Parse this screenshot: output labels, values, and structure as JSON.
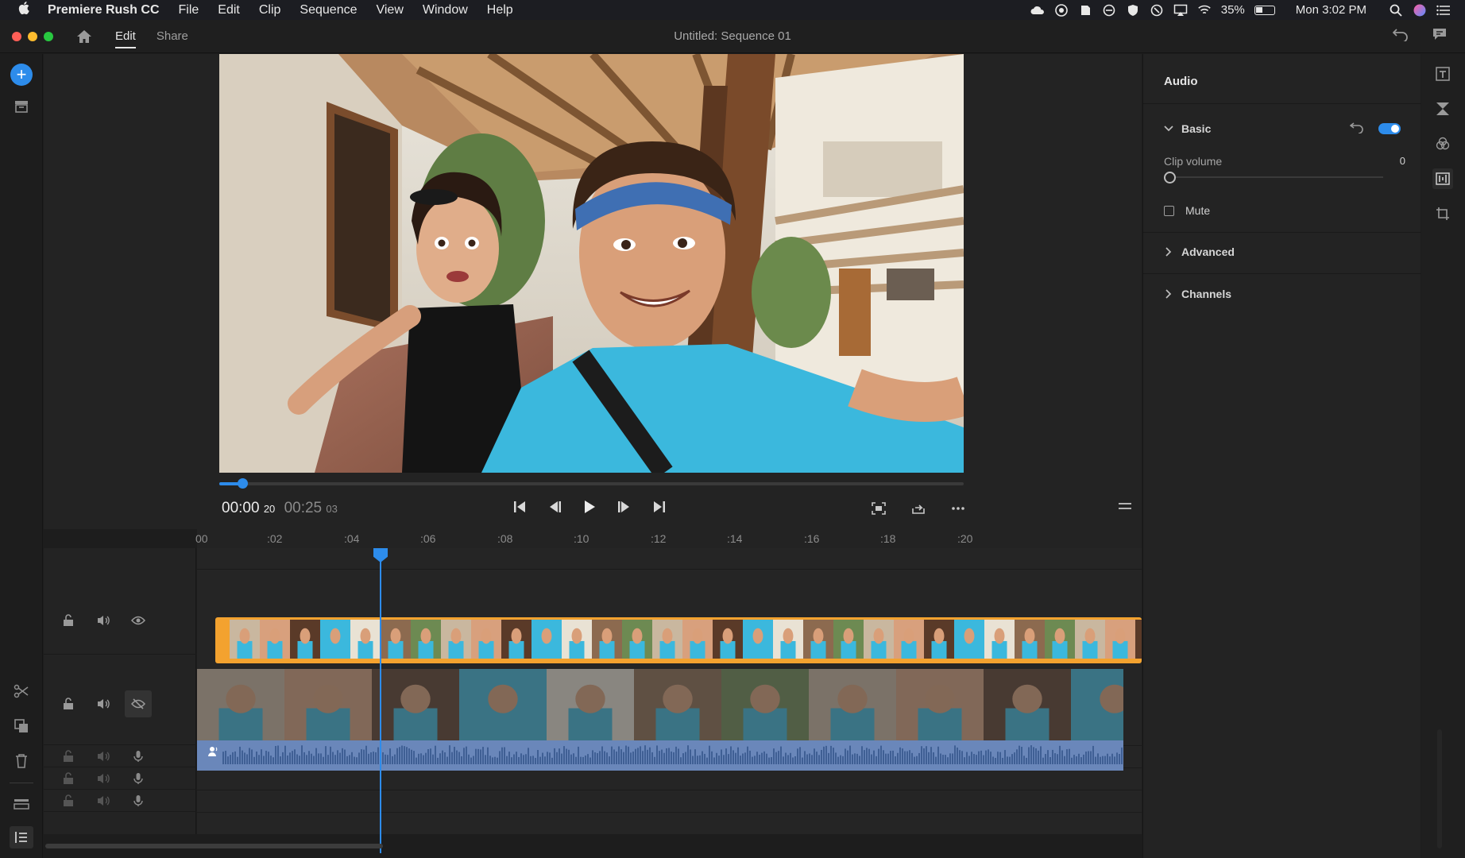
{
  "menubar": {
    "app_name": "Premiere Rush CC",
    "items": [
      "File",
      "Edit",
      "Clip",
      "Sequence",
      "View",
      "Window",
      "Help"
    ],
    "battery": "35%",
    "clock": "Mon 3:02 PM"
  },
  "titlebar": {
    "tabs": [
      {
        "label": "Edit",
        "active": true
      },
      {
        "label": "Share",
        "active": false
      }
    ],
    "title": "Untitled: Sequence 01"
  },
  "preview": {
    "current_time": "00:00",
    "current_frames": "20",
    "duration_time": "00:25",
    "duration_frames": "03",
    "playhead_fraction": 0.031
  },
  "timeline": {
    "ruler_labels": [
      "00",
      ":02",
      ":04",
      ":06",
      ":08",
      ":10",
      ":12",
      ":14",
      ":16",
      ":18",
      ":20"
    ],
    "tracks": [
      {
        "kind": "video-overlay",
        "locked": false,
        "muted": false,
        "visible": true
      },
      {
        "kind": "video-main",
        "locked": false,
        "muted": false,
        "visible": false
      },
      {
        "kind": "audio",
        "locked": false
      },
      {
        "kind": "audio",
        "locked": false
      },
      {
        "kind": "audio",
        "locked": false
      }
    ]
  },
  "audio_panel": {
    "title": "Audio",
    "sections": [
      {
        "label": "Basic",
        "expanded": true,
        "enabled": true
      },
      {
        "label": "Advanced",
        "expanded": false
      },
      {
        "label": "Channels",
        "expanded": false
      }
    ],
    "clip_volume_label": "Clip volume",
    "clip_volume_value": "0",
    "mute_label": "Mute",
    "mute_checked": false
  },
  "colors": {
    "accent": "#2d8ceb",
    "clip_selected": "#f3a22f",
    "audio_wave": "#6a87ba"
  }
}
